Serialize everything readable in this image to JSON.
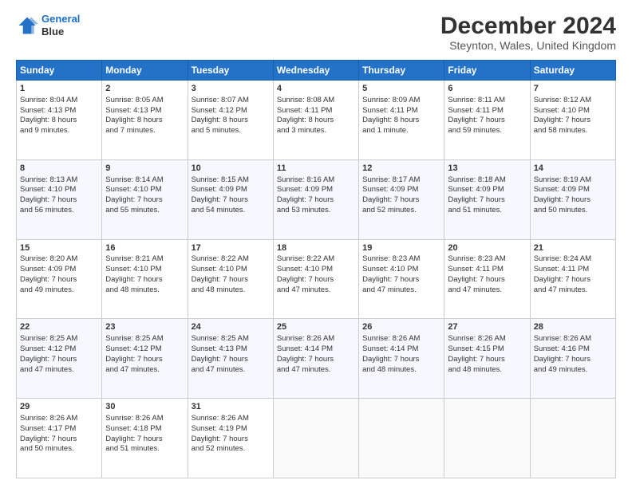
{
  "logo": {
    "line1": "General",
    "line2": "Blue"
  },
  "title": "December 2024",
  "subtitle": "Steynton, Wales, United Kingdom",
  "days_of_week": [
    "Sunday",
    "Monday",
    "Tuesday",
    "Wednesday",
    "Thursday",
    "Friday",
    "Saturday"
  ],
  "weeks": [
    [
      {
        "day": 1,
        "lines": [
          "Sunrise: 8:04 AM",
          "Sunset: 4:13 PM",
          "Daylight: 8 hours",
          "and 9 minutes."
        ]
      },
      {
        "day": 2,
        "lines": [
          "Sunrise: 8:05 AM",
          "Sunset: 4:13 PM",
          "Daylight: 8 hours",
          "and 7 minutes."
        ]
      },
      {
        "day": 3,
        "lines": [
          "Sunrise: 8:07 AM",
          "Sunset: 4:12 PM",
          "Daylight: 8 hours",
          "and 5 minutes."
        ]
      },
      {
        "day": 4,
        "lines": [
          "Sunrise: 8:08 AM",
          "Sunset: 4:11 PM",
          "Daylight: 8 hours",
          "and 3 minutes."
        ]
      },
      {
        "day": 5,
        "lines": [
          "Sunrise: 8:09 AM",
          "Sunset: 4:11 PM",
          "Daylight: 8 hours",
          "and 1 minute."
        ]
      },
      {
        "day": 6,
        "lines": [
          "Sunrise: 8:11 AM",
          "Sunset: 4:11 PM",
          "Daylight: 7 hours",
          "and 59 minutes."
        ]
      },
      {
        "day": 7,
        "lines": [
          "Sunrise: 8:12 AM",
          "Sunset: 4:10 PM",
          "Daylight: 7 hours",
          "and 58 minutes."
        ]
      }
    ],
    [
      {
        "day": 8,
        "lines": [
          "Sunrise: 8:13 AM",
          "Sunset: 4:10 PM",
          "Daylight: 7 hours",
          "and 56 minutes."
        ]
      },
      {
        "day": 9,
        "lines": [
          "Sunrise: 8:14 AM",
          "Sunset: 4:10 PM",
          "Daylight: 7 hours",
          "and 55 minutes."
        ]
      },
      {
        "day": 10,
        "lines": [
          "Sunrise: 8:15 AM",
          "Sunset: 4:09 PM",
          "Daylight: 7 hours",
          "and 54 minutes."
        ]
      },
      {
        "day": 11,
        "lines": [
          "Sunrise: 8:16 AM",
          "Sunset: 4:09 PM",
          "Daylight: 7 hours",
          "and 53 minutes."
        ]
      },
      {
        "day": 12,
        "lines": [
          "Sunrise: 8:17 AM",
          "Sunset: 4:09 PM",
          "Daylight: 7 hours",
          "and 52 minutes."
        ]
      },
      {
        "day": 13,
        "lines": [
          "Sunrise: 8:18 AM",
          "Sunset: 4:09 PM",
          "Daylight: 7 hours",
          "and 51 minutes."
        ]
      },
      {
        "day": 14,
        "lines": [
          "Sunrise: 8:19 AM",
          "Sunset: 4:09 PM",
          "Daylight: 7 hours",
          "and 50 minutes."
        ]
      }
    ],
    [
      {
        "day": 15,
        "lines": [
          "Sunrise: 8:20 AM",
          "Sunset: 4:09 PM",
          "Daylight: 7 hours",
          "and 49 minutes."
        ]
      },
      {
        "day": 16,
        "lines": [
          "Sunrise: 8:21 AM",
          "Sunset: 4:10 PM",
          "Daylight: 7 hours",
          "and 48 minutes."
        ]
      },
      {
        "day": 17,
        "lines": [
          "Sunrise: 8:22 AM",
          "Sunset: 4:10 PM",
          "Daylight: 7 hours",
          "and 48 minutes."
        ]
      },
      {
        "day": 18,
        "lines": [
          "Sunrise: 8:22 AM",
          "Sunset: 4:10 PM",
          "Daylight: 7 hours",
          "and 47 minutes."
        ]
      },
      {
        "day": 19,
        "lines": [
          "Sunrise: 8:23 AM",
          "Sunset: 4:10 PM",
          "Daylight: 7 hours",
          "and 47 minutes."
        ]
      },
      {
        "day": 20,
        "lines": [
          "Sunrise: 8:23 AM",
          "Sunset: 4:11 PM",
          "Daylight: 7 hours",
          "and 47 minutes."
        ]
      },
      {
        "day": 21,
        "lines": [
          "Sunrise: 8:24 AM",
          "Sunset: 4:11 PM",
          "Daylight: 7 hours",
          "and 47 minutes."
        ]
      }
    ],
    [
      {
        "day": 22,
        "lines": [
          "Sunrise: 8:25 AM",
          "Sunset: 4:12 PM",
          "Daylight: 7 hours",
          "and 47 minutes."
        ]
      },
      {
        "day": 23,
        "lines": [
          "Sunrise: 8:25 AM",
          "Sunset: 4:12 PM",
          "Daylight: 7 hours",
          "and 47 minutes."
        ]
      },
      {
        "day": 24,
        "lines": [
          "Sunrise: 8:25 AM",
          "Sunset: 4:13 PM",
          "Daylight: 7 hours",
          "and 47 minutes."
        ]
      },
      {
        "day": 25,
        "lines": [
          "Sunrise: 8:26 AM",
          "Sunset: 4:14 PM",
          "Daylight: 7 hours",
          "and 47 minutes."
        ]
      },
      {
        "day": 26,
        "lines": [
          "Sunrise: 8:26 AM",
          "Sunset: 4:14 PM",
          "Daylight: 7 hours",
          "and 48 minutes."
        ]
      },
      {
        "day": 27,
        "lines": [
          "Sunrise: 8:26 AM",
          "Sunset: 4:15 PM",
          "Daylight: 7 hours",
          "and 48 minutes."
        ]
      },
      {
        "day": 28,
        "lines": [
          "Sunrise: 8:26 AM",
          "Sunset: 4:16 PM",
          "Daylight: 7 hours",
          "and 49 minutes."
        ]
      }
    ],
    [
      {
        "day": 29,
        "lines": [
          "Sunrise: 8:26 AM",
          "Sunset: 4:17 PM",
          "Daylight: 7 hours",
          "and 50 minutes."
        ]
      },
      {
        "day": 30,
        "lines": [
          "Sunrise: 8:26 AM",
          "Sunset: 4:18 PM",
          "Daylight: 7 hours",
          "and 51 minutes."
        ]
      },
      {
        "day": 31,
        "lines": [
          "Sunrise: 8:26 AM",
          "Sunset: 4:19 PM",
          "Daylight: 7 hours",
          "and 52 minutes."
        ]
      },
      null,
      null,
      null,
      null
    ]
  ]
}
